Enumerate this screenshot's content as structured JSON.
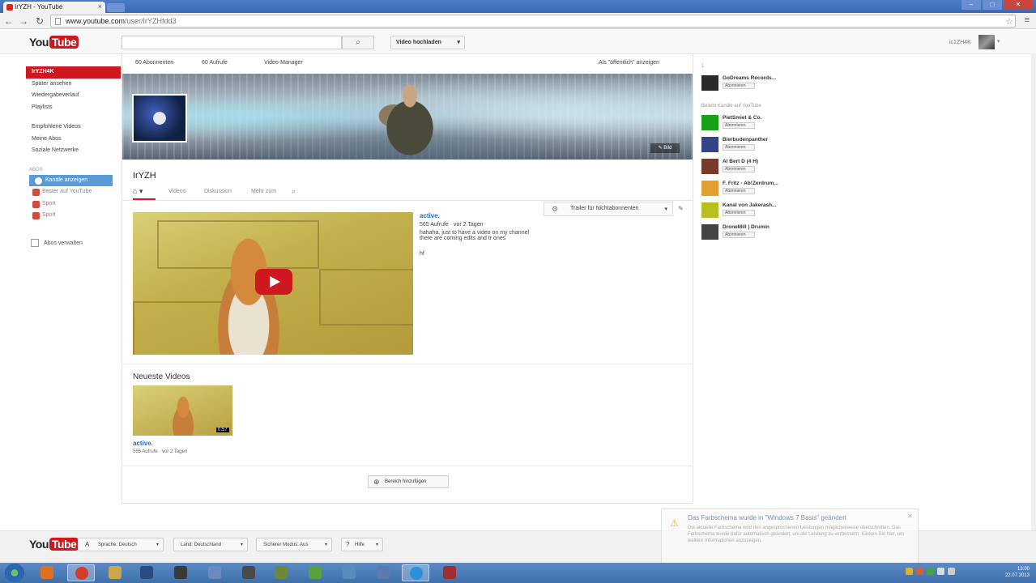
{
  "browser": {
    "tab_title": "IrYZH - YouTube",
    "tab_close": "×",
    "url_host": "www.youtube.com",
    "url_path": "/user/IrYZHfdd3",
    "window_controls": [
      "–",
      "□",
      "✕"
    ]
  },
  "yt_header": {
    "logo_you": "You",
    "logo_tube": "Tube",
    "search_placeholder": "",
    "search_icon": "search-icon",
    "upload_label": "Video hochladen",
    "upload_caret": "▾",
    "username": "ic1ZH4K",
    "avatar_caret": "▾"
  },
  "guide": {
    "items": [
      "IrYZH4K",
      "Später ansehen",
      "Wiedergabeverlauf",
      "Playlists"
    ],
    "items2": [
      "Empfohlene Videos",
      "Meine Abos",
      "Soziale Netzwerke"
    ],
    "section_head": "ABOS",
    "subs": [
      "Kanäle anzeigen",
      "Bester auf YouTube",
      "Sport",
      "Sport"
    ],
    "manage": "Abos verwalten"
  },
  "channel": {
    "stats": [
      "60 Abonnenten",
      "60 Aufrufe",
      "Video-Manager"
    ],
    "view_as": "Als \"öffentlich\" anzeigen",
    "banner_edit": "✎ Bild",
    "name": "IrYZH",
    "home_icon": "⌂ ▾",
    "tabs": [
      "Videos",
      "Diskussion",
      "Mehr zum"
    ],
    "tab_search_icon": "⌕",
    "trailer_label": "Trailer für Nichtabonnenten",
    "trailer_gear": "⚙",
    "trailer_caret": "▾",
    "edit_icon": "✎",
    "featured": {
      "title": "active.",
      "meta": "565 Aufrufe · vor 2 Tagen",
      "desc1": "hahaha, just to have a video on my channel",
      "desc2": "there are coming edits and tr ones",
      "extra": "hf"
    },
    "newest_heading": "Neueste Videos",
    "thumb": {
      "duration": "0:57",
      "title": "active.",
      "views": "565 Aufrufe",
      "age": "vor 2 Tagen"
    },
    "add_section": "Bereich hinzufügen",
    "add_icon": "⊕"
  },
  "right": {
    "head1": "1",
    "head2": "Beliebt Kanäle auf YouTube",
    "sub_label": "Abonnieren",
    "channels": [
      {
        "name": "GoDreams Records...",
        "color": "#2a2a2a"
      },
      {
        "name": "PietSmiet & Co.",
        "color": "#18a018"
      },
      {
        "name": "Bierbudenpanther",
        "color": "#334488"
      },
      {
        "name": "Al Bert D (4 H)",
        "color": "#7a3a2a"
      },
      {
        "name": "F. Fritz - Ab!Zerdrum...",
        "color": "#e2a030"
      },
      {
        "name": "Kanal von Jakerash...",
        "color": "#b8c020"
      },
      {
        "name": "DroneMill | Drumin",
        "color": "#444444"
      }
    ]
  },
  "footer": {
    "logo_you": "You",
    "logo_tube": "Tube",
    "buttons": [
      "Sprache: Deutsch",
      "Land: Deutschland",
      "Sicherer Modus: Aus",
      "Hilfe"
    ],
    "caret": "▾"
  },
  "notification": {
    "title": "Das Farbschema wurde in \"Windows 7 Basis\" geändert",
    "text": "Die aktuelle Farbschema wird den angesprochenen Leistungen möglicherweise überschnitten. Das Farbschema wurde dafür automatisch geändert, um die Leistung zu verbessern. Klicken Sie hier, um weitere Informationen anzuzeigen.",
    "icon": "⚠",
    "close": "✕"
  },
  "taskbar": {
    "time": "13:00",
    "date": "22.07.2013",
    "icons": [
      "#e07020",
      "#d33d2b",
      "#c9a84c",
      "#2a4c80",
      "#3a3a3a",
      "#6a8ac0",
      "#4a4a4a",
      "#6a8a3a",
      "#5aa040",
      "#5a8ac0",
      "#5a7ab0",
      "#2a90d8",
      "#a03030"
    ]
  }
}
